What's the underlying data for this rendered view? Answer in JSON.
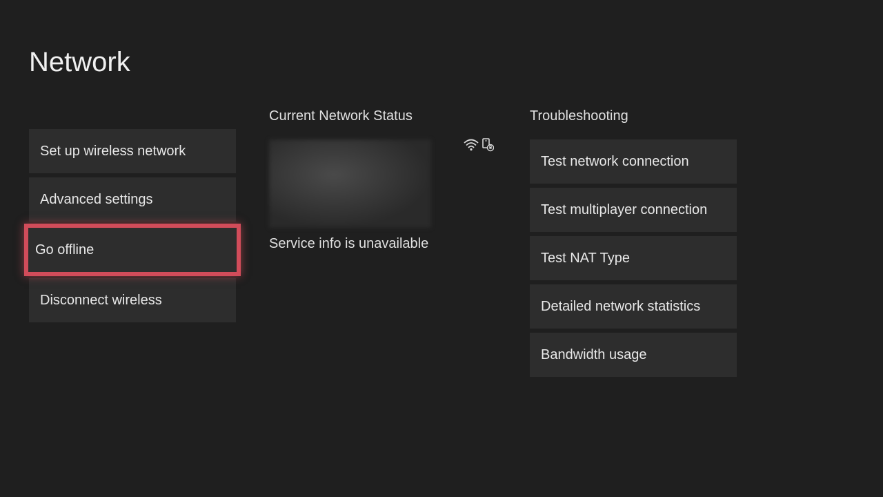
{
  "page": {
    "title": "Network"
  },
  "left_menu": {
    "items": [
      {
        "label": "Set up wireless network",
        "highlighted": false
      },
      {
        "label": "Advanced settings",
        "highlighted": false
      },
      {
        "label": "Go offline",
        "highlighted": true
      },
      {
        "label": "Disconnect wireless",
        "highlighted": false
      }
    ]
  },
  "status": {
    "heading": "Current Network Status",
    "message": "Service info is unavailable"
  },
  "troubleshooting": {
    "heading": "Troubleshooting",
    "items": [
      {
        "label": "Test network connection"
      },
      {
        "label": "Test multiplayer connection"
      },
      {
        "label": "Test NAT Type"
      },
      {
        "label": "Detailed network statistics"
      },
      {
        "label": "Bandwidth usage"
      }
    ]
  },
  "highlight_color": "#d14c5a"
}
